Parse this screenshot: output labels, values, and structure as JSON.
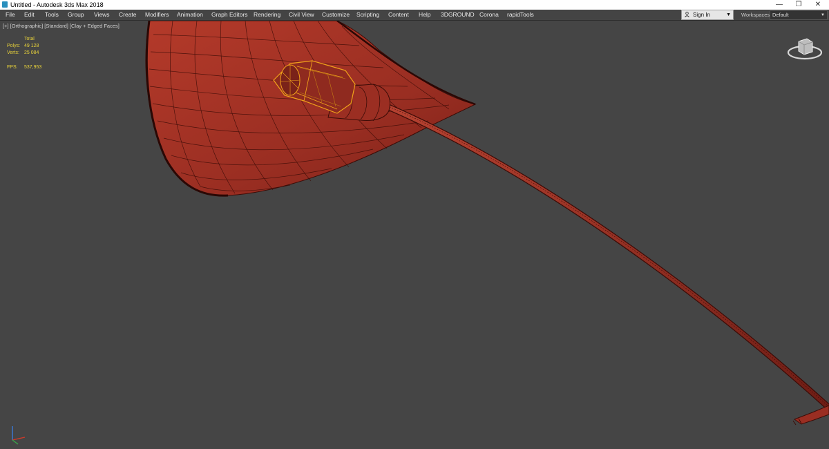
{
  "window": {
    "title": "Untitled - Autodesk 3ds Max 2018",
    "minimize_icon": "minimize-icon",
    "maximize_icon": "restore-icon",
    "close_icon": "close-icon",
    "minimize_glyph": "—",
    "maximize_glyph": "❐",
    "close_glyph": "✕"
  },
  "menu": {
    "items": [
      "File",
      "Edit",
      "Tools",
      "Group",
      "Views",
      "Create",
      "Modifiers",
      "Animation",
      "Graph Editors",
      "Rendering",
      "Civil View",
      "Customize",
      "Scripting",
      "Content",
      "Help",
      "3DGROUND",
      "Corona",
      "rapidTools"
    ]
  },
  "account": {
    "signin_label": "Sign In",
    "icon": "user-icon"
  },
  "workspaces": {
    "label": "Workspaces:",
    "value": "Default"
  },
  "viewport": {
    "label": "[+] [Orthographic] [Standard] [Clay + Edged Faces]",
    "stats": {
      "total_label": "Total",
      "polys_label": "Polys:",
      "polys_value": "49 128",
      "verts_label": "Verts:",
      "verts_value": "25 084",
      "fps_label": "FPS:",
      "fps_value": "537,953"
    },
    "navigation_icon": "viewcube-icon",
    "axis_icon": "axis-tripod-icon"
  },
  "colors": {
    "viewport_bg": "#454545",
    "mesh": "#9e2f22",
    "wire": "#3c0c07",
    "selection": "#f0a21a",
    "stats_text": "#e8d23a"
  }
}
